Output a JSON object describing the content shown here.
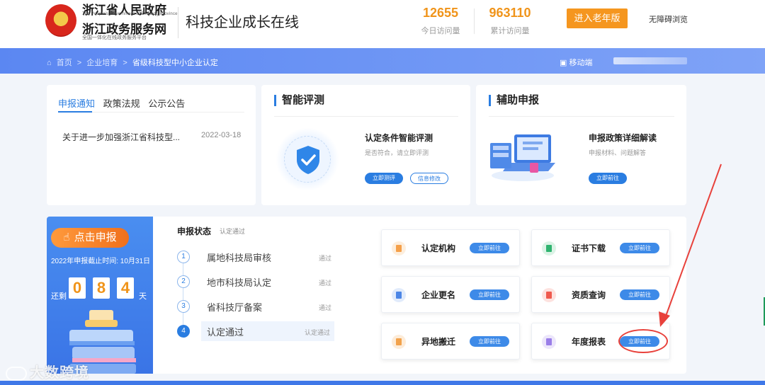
{
  "header": {
    "org_name": "浙江省人民政府",
    "org_name_en": "The People's Government of Zhejiang Province",
    "service_name": "浙江政务服务网",
    "service_tagline": "全国一体化在线政务服务平台",
    "site_title": "科技企业成长在线",
    "stats": [
      {
        "value": "12655",
        "label": "今日访问量"
      },
      {
        "value": "963110",
        "label": "累计访问量"
      }
    ],
    "elder_mode_label": "进入老年版",
    "accessibility_label": "无障碍浏览"
  },
  "nav": {
    "breadcrumbs": [
      "首页",
      "企业培育",
      "省级科技型中小企业认定"
    ],
    "mobile_label": "移动端"
  },
  "notice": {
    "tabs": [
      "申报通知",
      "政策法规",
      "公示公告"
    ],
    "items": [
      {
        "title": "关于进一步加强浙江省科技型...",
        "date": "2022-03-18"
      }
    ]
  },
  "evaluation": {
    "heading": "智能评测",
    "title": "认定条件智能评测",
    "desc": "是否符合，请立即评测",
    "btn_primary": "立即测评",
    "btn_secondary": "信息修改"
  },
  "assist": {
    "heading": "辅助申报",
    "title": "申报政策详细解读",
    "desc": "申报材料、问题解答",
    "btn": "立即前往"
  },
  "apply": {
    "button_label": "点击申报",
    "deadline": "2022年申报截止时间: 10月31日",
    "remain_label": "还剩",
    "digits": [
      "0",
      "8",
      "4"
    ],
    "days_label": "天"
  },
  "status": {
    "heading": "申报状态",
    "current": "认定通过",
    "steps": [
      {
        "num": "1",
        "label": "属地科技局审核",
        "state": "通过"
      },
      {
        "num": "2",
        "label": "地市科技局认定",
        "state": "通过"
      },
      {
        "num": "3",
        "label": "省科技厅备案",
        "state": "通过"
      },
      {
        "num": "4",
        "label": "认定通过",
        "state": "认定通过"
      }
    ]
  },
  "services": {
    "go_label": "立即前往",
    "items": [
      {
        "name": "认定机构",
        "icon": "building-icon",
        "color": "#f5a04a"
      },
      {
        "name": "证书下载",
        "icon": "certificate-icon",
        "color": "#2fb36f"
      },
      {
        "name": "企业更名",
        "icon": "edit-icon",
        "color": "#4c86e6"
      },
      {
        "name": "资质查询",
        "icon": "search-doc-icon",
        "color": "#ef5a4e"
      },
      {
        "name": "异地搬迁",
        "icon": "relocate-icon",
        "color": "#f2a24c"
      },
      {
        "name": "年度报表",
        "icon": "report-icon",
        "color": "#9a7ee8"
      }
    ]
  },
  "watermark": "大数跨境",
  "colors": {
    "primary": "#2a7de1",
    "accent": "#f0941a",
    "annotation": "#e8413b"
  }
}
